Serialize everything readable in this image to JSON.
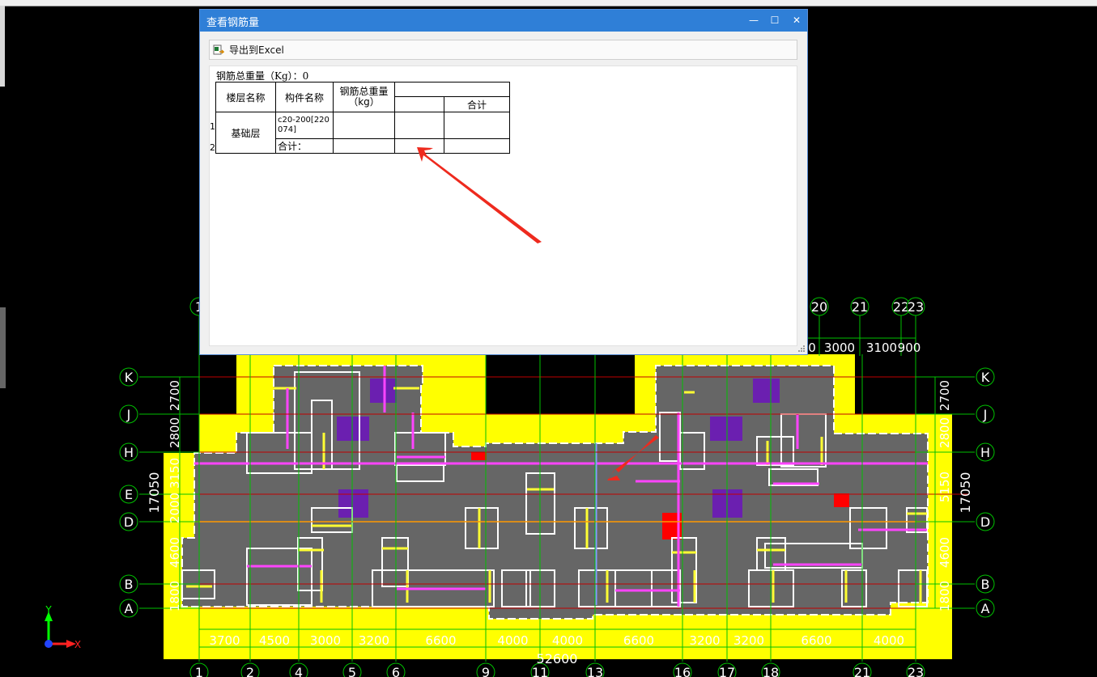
{
  "window": {
    "title": "查看钢筋量",
    "minimize_glyph": "—",
    "maximize_glyph": "☐",
    "close_glyph": "✕"
  },
  "toolbar": {
    "export_label": "导出到Excel",
    "export_icon": "excel-export-icon"
  },
  "report": {
    "total_weight_line": "钢筋总重量（Kg）：0",
    "headers": {
      "floor": "楼层名称",
      "component": "构件名称",
      "total_weight": "钢筋总重量\n（kg）",
      "subtotal": "合计"
    },
    "row_numbers": [
      "1",
      "2"
    ],
    "rows": {
      "floor": "基础层",
      "component": "c20-200[220074]",
      "sum_label": "合计："
    }
  },
  "cad": {
    "colors": {
      "background": "#000000",
      "slab": "#ffff00",
      "fill": "#666666",
      "grid": "#c00000",
      "axis": "#00c000",
      "beam": "#ff44ff",
      "column": "#6b1fb0",
      "arrow": "#ee2a1e"
    },
    "axis_labels_bottom": [
      "1",
      "2",
      "4",
      "5",
      "6",
      "9",
      "11",
      "13",
      "16",
      "17",
      "18",
      "21",
      "23"
    ],
    "axis_labels_top": [
      "1",
      "20",
      "21",
      "22",
      "23"
    ],
    "axis_labels_left": [
      "K",
      "J",
      "H",
      "E",
      "D",
      "B",
      "A"
    ],
    "axis_labels_right": [
      "K",
      "J",
      "H",
      "D",
      "B",
      "A"
    ],
    "dim_bottom": [
      "3700",
      "4500",
      "3000",
      "3200",
      "6600",
      "4000",
      "4000",
      "6600",
      "3200",
      "3200",
      "6600",
      "4000"
    ],
    "dim_bottom_total": "52600",
    "dim_top_right": [
      "0",
      "3000",
      "3100",
      "900"
    ],
    "dim_left_inner": [
      "2700",
      "2800",
      "3150",
      "2000",
      "4600",
      "1800"
    ],
    "dim_left_total": "17050",
    "dim_right_inner": [
      "2700",
      "2800",
      "5150",
      "4600",
      "1800"
    ],
    "dim_right_total": "17050",
    "ucs": {
      "x": "X",
      "y": "Y"
    }
  }
}
